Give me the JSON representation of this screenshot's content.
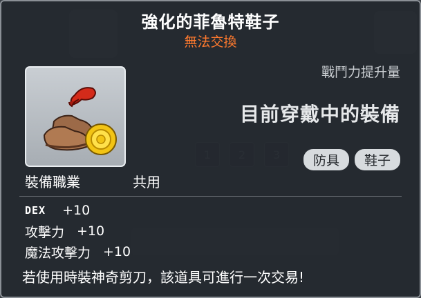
{
  "item": {
    "name": "強化的菲魯特鞋子",
    "trade_status": "無法交換",
    "power_label": "戰鬥力提升量",
    "equip_status": "目前穿戴中的裝備",
    "tags": [
      "防具",
      "鞋子"
    ]
  },
  "requirements": {
    "job_label": "裝備職業",
    "job_value": "共用"
  },
  "stats": [
    {
      "name": "DEX",
      "value": "+10"
    },
    {
      "name": "攻擊力",
      "value": "+10"
    },
    {
      "name": "魔法攻擊力",
      "value": "+10"
    }
  ],
  "note": "若使用時裝神奇剪刀，該道具可進行一次交易!",
  "background": {
    "slots": [
      "1",
      "2",
      "3"
    ]
  },
  "colors": {
    "title": "#ffffff",
    "untradeable": "#ff7a2e",
    "tag_bg": "#d7dbde",
    "panel_bg": "#22272d"
  },
  "icons": {
    "item": "boots-with-gold-coin-icon"
  }
}
